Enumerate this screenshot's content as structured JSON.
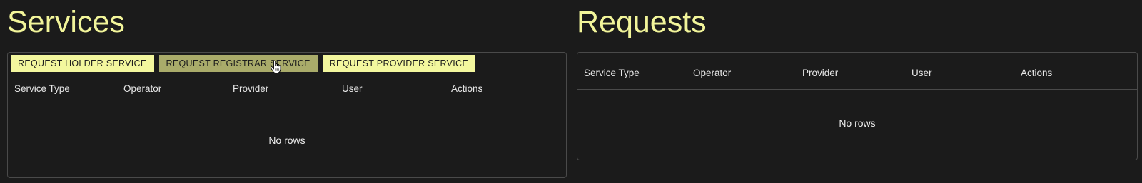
{
  "services": {
    "title": "Services",
    "toolbar": {
      "holder_label": "REQUEST HOLDER SERVICE",
      "registrar_label": "REQUEST REGISTRAR SERVICE",
      "provider_label": "REQUEST PROVIDER SERVICE"
    },
    "columns": [
      "Service Type",
      "Operator",
      "Provider",
      "User",
      "Actions"
    ],
    "empty_text": "No rows"
  },
  "requests": {
    "title": "Requests",
    "columns": [
      "Service Type",
      "Operator",
      "Provider",
      "User",
      "Actions"
    ],
    "empty_text": "No rows"
  },
  "colors": {
    "accent": "#f2f59a",
    "button_bg": "#f3f79e",
    "button_hover_bg": "#a9ab6a",
    "background": "#1b1b1b",
    "border": "#4a4a4a"
  },
  "icons": {
    "cursor": "hand-pointer-icon"
  }
}
